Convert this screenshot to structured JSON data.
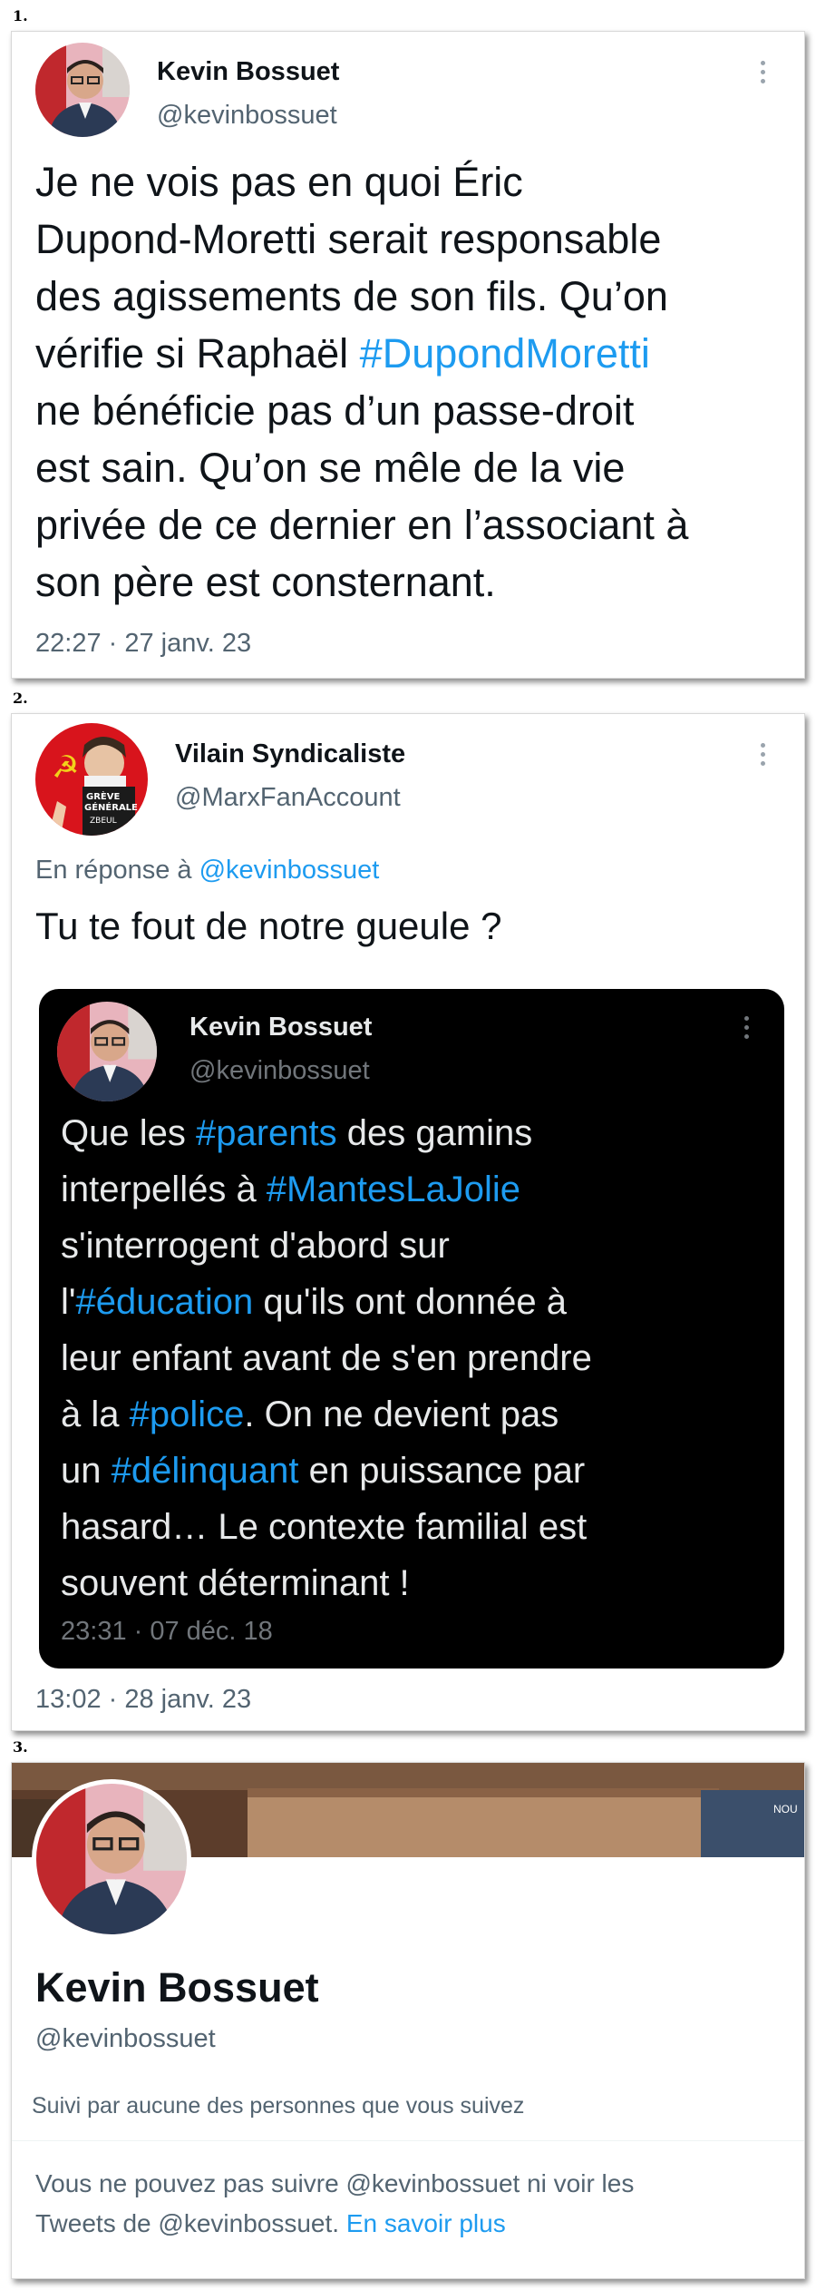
{
  "panels": [
    {
      "label": "1.",
      "author": {
        "name": "Kevin Bossuet",
        "handle": "@kevinbossuet"
      },
      "text_lines": [
        [
          {
            "t": "Je ne vois pas en quoi Éric"
          }
        ],
        [
          {
            "t": "Dupond-Moretti serait responsable"
          }
        ],
        [
          {
            "t": "des agissements de son fils. Qu’on"
          }
        ],
        [
          {
            "t": "vérifie si Raphaël "
          },
          {
            "t": "#DupondMoretti",
            "tag": true
          }
        ],
        [
          {
            "t": "ne bénéficie pas d’un passe-droit"
          }
        ],
        [
          {
            "t": "est sain. Qu’on se mêle de la vie"
          }
        ],
        [
          {
            "t": "privée de ce dernier en l’associant à"
          }
        ],
        [
          {
            "t": "son père est consternant."
          }
        ]
      ],
      "timestamp": "22:27 · 27 janv. 23"
    },
    {
      "label": "2.",
      "author": {
        "name": "Vilain Syndicaliste",
        "handle": "@MarxFanAccount"
      },
      "reply_prefix": "En réponse à ",
      "reply_handle": "@kevinbossuet",
      "text": "Tu te fout de notre gueule ?",
      "quote": {
        "author": {
          "name": "Kevin Bossuet",
          "handle": "@kevinbossuet"
        },
        "text_lines": [
          [
            {
              "t": "Que les "
            },
            {
              "t": "#parents",
              "tag": true
            },
            {
              "t": " des gamins"
            }
          ],
          [
            {
              "t": "interpellés à "
            },
            {
              "t": "#MantesLaJolie",
              "tag": true
            }
          ],
          [
            {
              "t": "s'interrogent d'abord sur"
            }
          ],
          [
            {
              "t": "l'"
            },
            {
              "t": "#éducation",
              "tag": true
            },
            {
              "t": " qu'ils ont donnée à"
            }
          ],
          [
            {
              "t": "leur enfant avant de s'en prendre"
            }
          ],
          [
            {
              "t": "à la "
            },
            {
              "t": "#police",
              "tag": true
            },
            {
              "t": ". On ne devient pas"
            }
          ],
          [
            {
              "t": "un "
            },
            {
              "t": "#délinquant",
              "tag": true
            },
            {
              "t": " en puissance par"
            }
          ],
          [
            {
              "t": "hasard… Le contexte familial est"
            }
          ],
          [
            {
              "t": "souvent déterminant !"
            }
          ]
        ],
        "timestamp": "23:31 · 07 déc. 18"
      },
      "timestamp": "13:02 · 28 janv. 23"
    },
    {
      "label": "3.",
      "profile": {
        "name": "Kevin Bossuet",
        "handle": "@kevinbossuet",
        "followed_by": "Suivi par aucune des personnes que vous suivez",
        "blocked_line1": "Vous ne pouvez pas suivre @kevinbossuet ni voir les",
        "blocked_line2": "Tweets de @kevinbossuet. ",
        "learn_more": "En savoir plus"
      }
    }
  ],
  "banner_fragment": "NOU",
  "colors": {
    "link": "#1d9bf0",
    "secondary_text": "#536471",
    "quote_bg": "#000000"
  },
  "icons": [
    "more-vertical-icon",
    "avatar-photo",
    "avatar-cartoon"
  ]
}
